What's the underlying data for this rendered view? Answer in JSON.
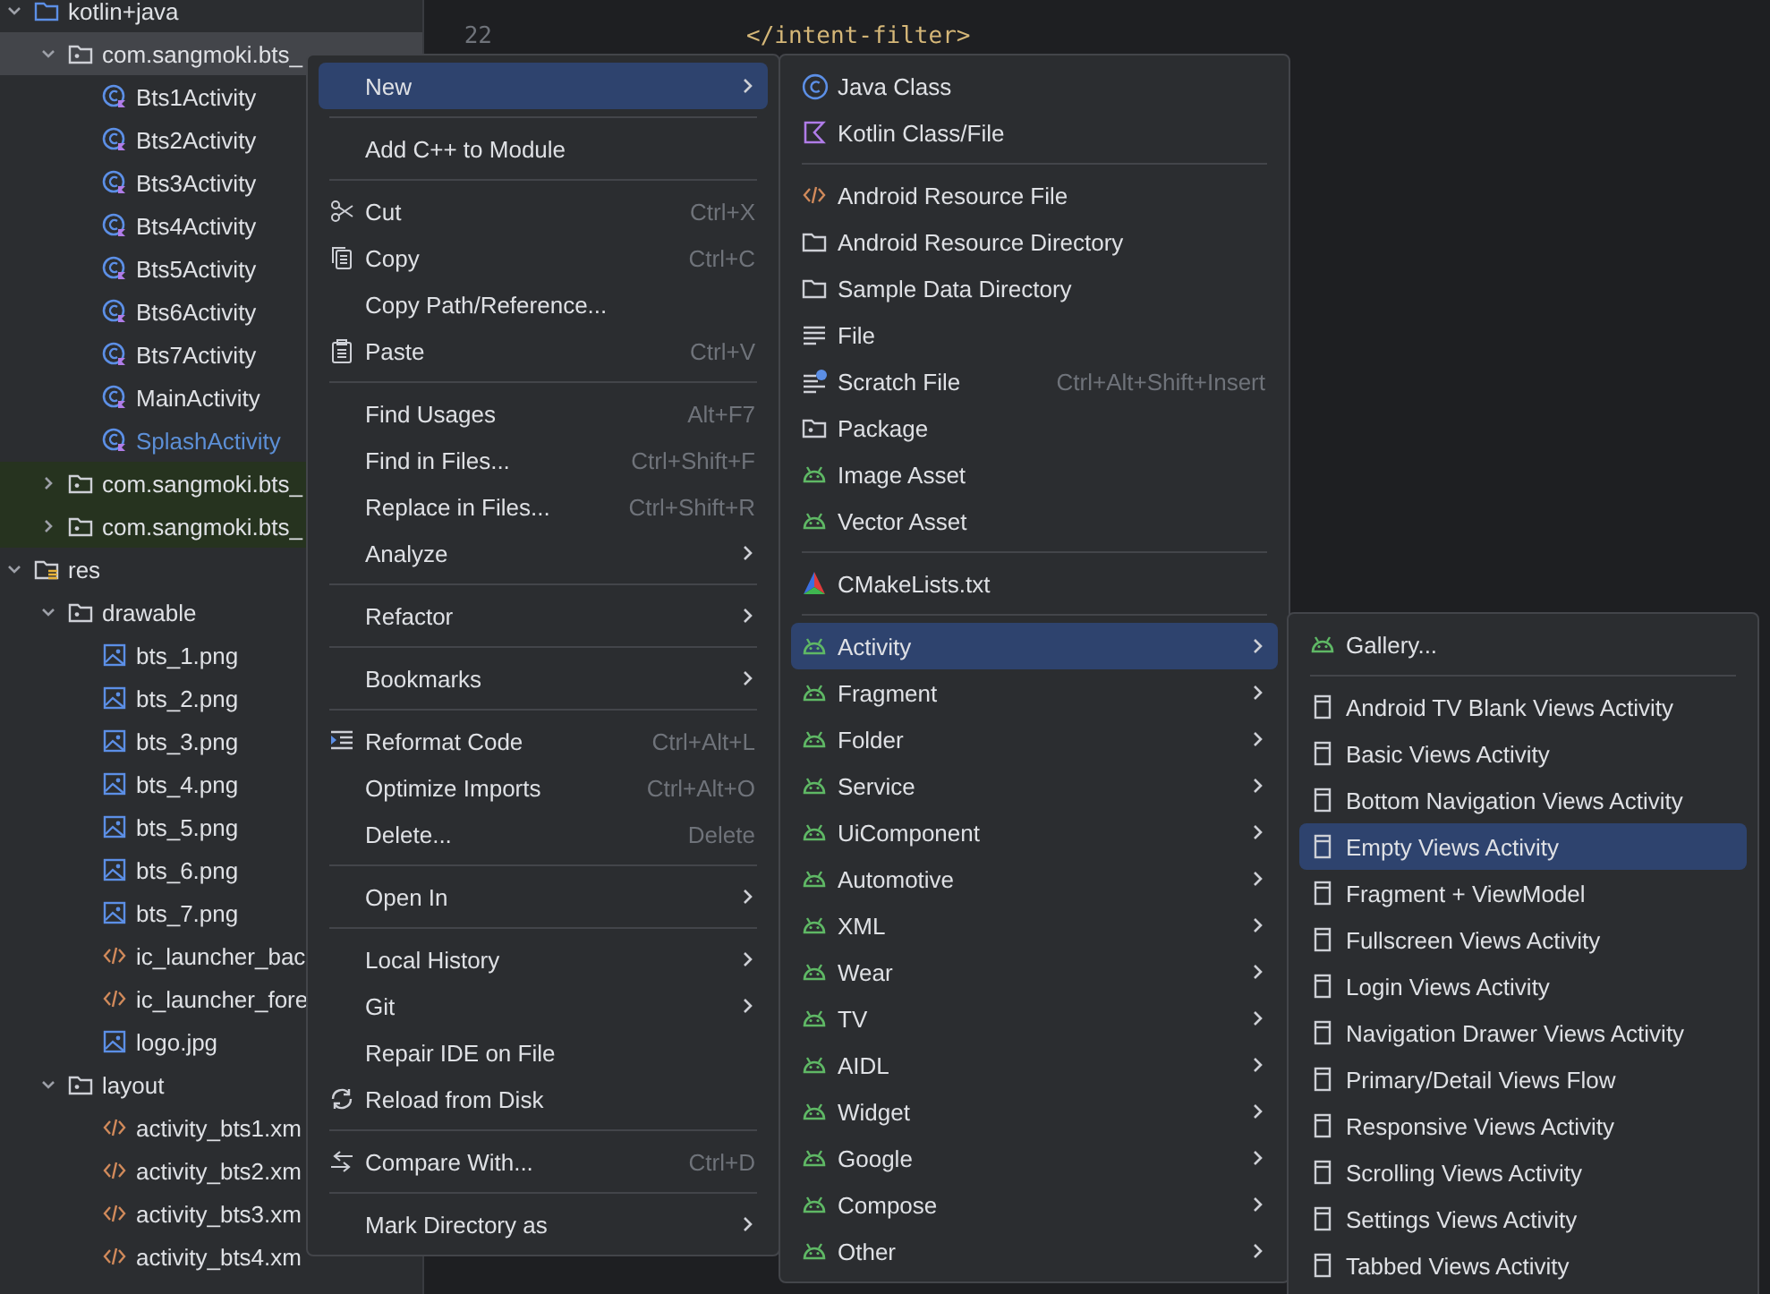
{
  "project_tree": [
    {
      "label": "kotlin+java",
      "kind": "folder",
      "expanded": true,
      "selected": false,
      "children": [
        {
          "label": "com.sangmoki.bts_",
          "kind": "package",
          "expanded": true,
          "selected": true,
          "children": [
            {
              "label": "Bts1Activity",
              "kind": "class",
              "selected": false,
              "modified": false
            },
            {
              "label": "Bts2Activity",
              "kind": "class",
              "selected": false,
              "modified": false
            },
            {
              "label": "Bts3Activity",
              "kind": "class",
              "selected": false,
              "modified": false
            },
            {
              "label": "Bts4Activity",
              "kind": "class",
              "selected": false,
              "modified": false
            },
            {
              "label": "Bts5Activity",
              "kind": "class",
              "selected": false,
              "modified": false
            },
            {
              "label": "Bts6Activity",
              "kind": "class",
              "selected": false,
              "modified": false
            },
            {
              "label": "Bts7Activity",
              "kind": "class",
              "selected": false,
              "modified": false
            },
            {
              "label": "MainActivity",
              "kind": "class",
              "selected": false,
              "modified": false
            },
            {
              "label": "SplashActivity",
              "kind": "class",
              "selected": false,
              "modified": true
            }
          ]
        },
        {
          "label": "com.sangmoki.bts_",
          "kind": "test-package",
          "expanded": false,
          "selected": false
        },
        {
          "label": "com.sangmoki.bts_",
          "kind": "test-package",
          "expanded": false,
          "selected": false
        }
      ]
    },
    {
      "label": "res",
      "kind": "res-folder",
      "expanded": true,
      "selected": false,
      "children": [
        {
          "label": "drawable",
          "kind": "package",
          "expanded": true,
          "selected": false,
          "children": [
            {
              "label": "bts_1.png",
              "kind": "image",
              "selected": false
            },
            {
              "label": "bts_2.png",
              "kind": "image",
              "selected": false
            },
            {
              "label": "bts_3.png",
              "kind": "image",
              "selected": false
            },
            {
              "label": "bts_4.png",
              "kind": "image",
              "selected": false
            },
            {
              "label": "bts_5.png",
              "kind": "image",
              "selected": false
            },
            {
              "label": "bts_6.png",
              "kind": "image",
              "selected": false
            },
            {
              "label": "bts_7.png",
              "kind": "image",
              "selected": false
            },
            {
              "label": "ic_launcher_bac",
              "kind": "xml",
              "selected": false
            },
            {
              "label": "ic_launcher_fore",
              "kind": "xml",
              "selected": false
            },
            {
              "label": "logo.jpg",
              "kind": "image",
              "selected": false
            }
          ]
        },
        {
          "label": "layout",
          "kind": "package",
          "expanded": true,
          "selected": false,
          "children": [
            {
              "label": "activity_bts1.xm",
              "kind": "xml",
              "selected": false
            },
            {
              "label": "activity_bts2.xm",
              "kind": "xml",
              "selected": false
            },
            {
              "label": "activity_bts3.xm",
              "kind": "xml",
              "selected": false
            },
            {
              "label": "activity_bts4.xm",
              "kind": "xml",
              "selected": false
            }
          ]
        }
      ]
    }
  ],
  "editor": {
    "lines": [
      {
        "number": "22",
        "code": "</intent-filter>"
      }
    ]
  },
  "context_menu": {
    "groups": [
      [
        {
          "label": "New",
          "submenu": true,
          "selected": true
        }
      ],
      [
        {
          "label": "Add C++ to Module",
          "submenu": false,
          "selected": false
        }
      ],
      [
        {
          "label": "Cut",
          "kind": "cut",
          "shortcut": "Ctrl+X",
          "submenu": false,
          "selected": false
        },
        {
          "label": "Copy",
          "kind": "copy",
          "shortcut": "Ctrl+C",
          "submenu": false,
          "selected": false
        },
        {
          "label": "Copy Path/Reference...",
          "submenu": false,
          "selected": false
        },
        {
          "label": "Paste",
          "kind": "paste",
          "shortcut": "Ctrl+V",
          "submenu": false,
          "selected": false
        }
      ],
      [
        {
          "label": "Find Usages",
          "shortcut": "Alt+F7",
          "submenu": false,
          "selected": false
        },
        {
          "label": "Find in Files...",
          "shortcut": "Ctrl+Shift+F",
          "submenu": false,
          "selected": false
        },
        {
          "label": "Replace in Files...",
          "shortcut": "Ctrl+Shift+R",
          "submenu": false,
          "selected": false
        },
        {
          "label": "Analyze",
          "submenu": true,
          "selected": false
        }
      ],
      [
        {
          "label": "Refactor",
          "submenu": true,
          "selected": false
        }
      ],
      [
        {
          "label": "Bookmarks",
          "submenu": true,
          "selected": false
        }
      ],
      [
        {
          "label": "Reformat Code",
          "kind": "reformat",
          "shortcut": "Ctrl+Alt+L",
          "submenu": false,
          "selected": false
        },
        {
          "label": "Optimize Imports",
          "shortcut": "Ctrl+Alt+O",
          "submenu": false,
          "selected": false
        },
        {
          "label": "Delete...",
          "shortcut": "Delete",
          "submenu": false,
          "selected": false
        }
      ],
      [
        {
          "label": "Open In",
          "submenu": true,
          "selected": false
        }
      ],
      [
        {
          "label": "Local History",
          "submenu": true,
          "selected": false
        },
        {
          "label": "Git",
          "submenu": true,
          "selected": false
        },
        {
          "label": "Repair IDE on File",
          "submenu": false,
          "selected": false
        },
        {
          "label": "Reload from Disk",
          "kind": "reload",
          "submenu": false,
          "selected": false
        }
      ],
      [
        {
          "label": "Compare With...",
          "kind": "compare",
          "shortcut": "Ctrl+D",
          "submenu": false,
          "selected": false
        }
      ],
      [
        {
          "label": "Mark Directory as",
          "submenu": true,
          "selected": false
        }
      ]
    ]
  },
  "new_submenu": {
    "groups": [
      [
        {
          "label": "Java Class",
          "kind": "java",
          "submenu": false,
          "selected": false
        },
        {
          "label": "Kotlin Class/File",
          "kind": "kotlin",
          "submenu": false,
          "selected": false
        }
      ],
      [
        {
          "label": "Android Resource File",
          "kind": "xml",
          "submenu": false,
          "selected": false
        },
        {
          "label": "Android Resource Directory",
          "kind": "folder",
          "submenu": false,
          "selected": false
        },
        {
          "label": "Sample Data Directory",
          "kind": "folder",
          "submenu": false,
          "selected": false
        },
        {
          "label": "File",
          "kind": "lines",
          "submenu": false,
          "selected": false
        },
        {
          "label": "Scratch File",
          "kind": "scratch",
          "shortcut": "Ctrl+Alt+Shift+Insert",
          "submenu": false,
          "selected": false
        },
        {
          "label": "Package",
          "kind": "package",
          "submenu": false,
          "selected": false
        },
        {
          "label": "Image Asset",
          "kind": "android",
          "submenu": false,
          "selected": false
        },
        {
          "label": "Vector Asset",
          "kind": "android",
          "submenu": false,
          "selected": false
        }
      ],
      [
        {
          "label": "CMakeLists.txt",
          "kind": "cmake",
          "submenu": false,
          "selected": false
        }
      ],
      [
        {
          "label": "Activity",
          "kind": "android",
          "submenu": true,
          "selected": true
        },
        {
          "label": "Fragment",
          "kind": "android",
          "submenu": true,
          "selected": false
        },
        {
          "label": "Folder",
          "kind": "android",
          "submenu": true,
          "selected": false
        },
        {
          "label": "Service",
          "kind": "android",
          "submenu": true,
          "selected": false
        },
        {
          "label": "UiComponent",
          "kind": "android",
          "submenu": true,
          "selected": false
        },
        {
          "label": "Automotive",
          "kind": "android",
          "submenu": true,
          "selected": false
        },
        {
          "label": "XML",
          "kind": "android",
          "submenu": true,
          "selected": false
        },
        {
          "label": "Wear",
          "kind": "android",
          "submenu": true,
          "selected": false
        },
        {
          "label": "TV",
          "kind": "android",
          "submenu": true,
          "selected": false
        },
        {
          "label": "AIDL",
          "kind": "android",
          "submenu": true,
          "selected": false
        },
        {
          "label": "Widget",
          "kind": "android",
          "submenu": true,
          "selected": false
        },
        {
          "label": "Google",
          "kind": "android",
          "submenu": true,
          "selected": false
        },
        {
          "label": "Compose",
          "kind": "android",
          "submenu": true,
          "selected": false
        },
        {
          "label": "Other",
          "kind": "android",
          "submenu": true,
          "selected": false
        }
      ]
    ]
  },
  "activity_submenu": {
    "groups": [
      [
        {
          "label": "Gallery...",
          "kind": "android",
          "submenu": false,
          "selected": false
        }
      ],
      [
        {
          "label": "Android TV Blank Views Activity",
          "kind": "template",
          "submenu": false,
          "selected": false
        },
        {
          "label": "Basic Views Activity",
          "kind": "template",
          "submenu": false,
          "selected": false
        },
        {
          "label": "Bottom Navigation Views Activity",
          "kind": "template",
          "submenu": false,
          "selected": false
        },
        {
          "label": "Empty Views Activity",
          "kind": "template",
          "submenu": false,
          "selected": true
        },
        {
          "label": "Fragment + ViewModel",
          "kind": "template",
          "submenu": false,
          "selected": false
        },
        {
          "label": "Fullscreen Views Activity",
          "kind": "template",
          "submenu": false,
          "selected": false
        },
        {
          "label": "Login Views Activity",
          "kind": "template",
          "submenu": false,
          "selected": false
        },
        {
          "label": "Navigation Drawer Views Activity",
          "kind": "template",
          "submenu": false,
          "selected": false
        },
        {
          "label": "Primary/Detail Views Flow",
          "kind": "template",
          "submenu": false,
          "selected": false
        },
        {
          "label": "Responsive Views Activity",
          "kind": "template",
          "submenu": false,
          "selected": false
        },
        {
          "label": "Scrolling Views Activity",
          "kind": "template",
          "submenu": false,
          "selected": false
        },
        {
          "label": "Settings Views Activity",
          "kind": "template",
          "submenu": false,
          "selected": false
        },
        {
          "label": "Tabbed Views Activity",
          "kind": "template",
          "submenu": false,
          "selected": false
        }
      ]
    ]
  }
}
